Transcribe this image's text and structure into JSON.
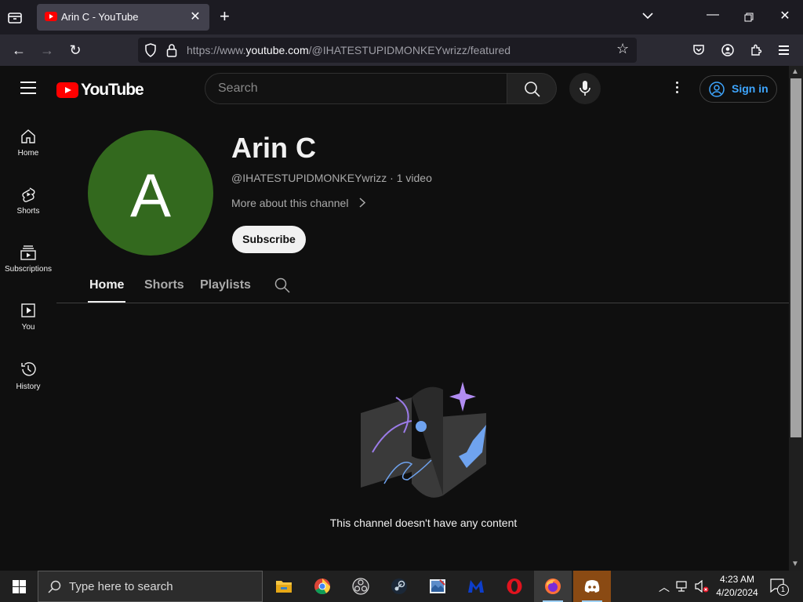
{
  "browser": {
    "tab_title": "Arin C - YouTube",
    "url_prefix": "https://www.",
    "url_host": "youtube.com",
    "url_path": "/@IHATESTUPIDMONKEYwrizz/featured"
  },
  "header": {
    "logo_text": "YouTube",
    "search_placeholder": "Search",
    "sign_in_label": "Sign in"
  },
  "sidebar": {
    "items": [
      {
        "label": "Home",
        "icon": "home-icon"
      },
      {
        "label": "Shorts",
        "icon": "shorts-icon"
      },
      {
        "label": "Subscriptions",
        "icon": "subscriptions-icon"
      },
      {
        "label": "You",
        "icon": "you-icon"
      },
      {
        "label": "History",
        "icon": "history-icon"
      }
    ]
  },
  "channel": {
    "avatar_letter": "A",
    "avatar_color": "#33691e",
    "name": "Arin C",
    "meta": "@IHATESTUPIDMONKEYwrizz · 1 video",
    "more_label": "More about this channel",
    "subscribe_label": "Subscribe",
    "tabs": [
      {
        "label": "Home",
        "active": true
      },
      {
        "label": "Shorts",
        "active": false
      },
      {
        "label": "Playlists",
        "active": false
      }
    ],
    "empty_message": "This channel doesn't have any content"
  },
  "taskbar": {
    "search_placeholder": "Type here to search",
    "apps": [
      "file-explorer-icon",
      "chrome-icon",
      "obs-icon",
      "steam-icon",
      "paint-icon",
      "malwarebytes-icon",
      "opera-icon",
      "firefox-icon",
      "discord-icon"
    ],
    "time": "4:23 AM",
    "date": "4/20/2024",
    "notification_count": "1"
  },
  "colors": {
    "accent_link": "#3ea6ff",
    "youtube_red": "#ff0000",
    "background": "#0f0f0f"
  }
}
